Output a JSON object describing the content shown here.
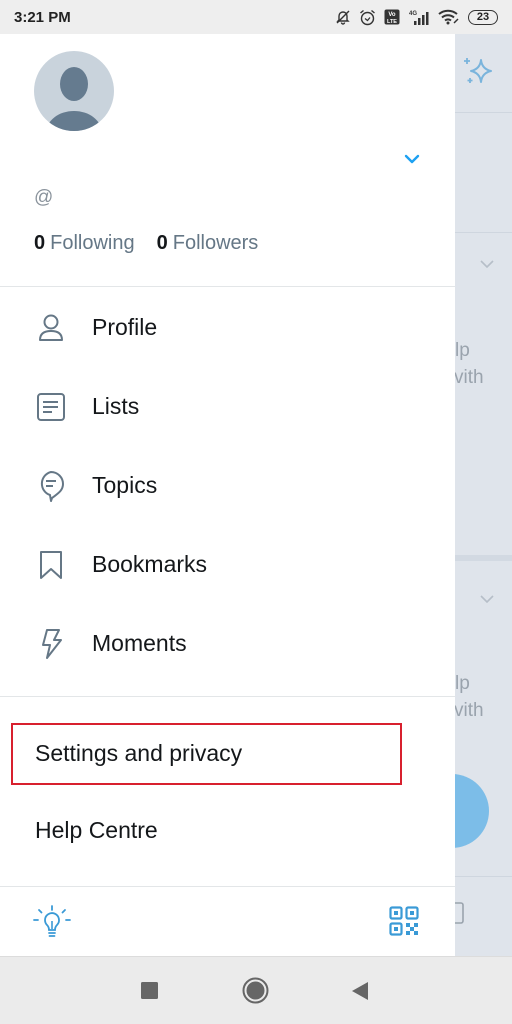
{
  "status_bar": {
    "time": "3:21 PM",
    "icons": [
      "notifications-off-icon",
      "alarm-icon",
      "volte-icon",
      "4g-signal-icon",
      "wifi-icon"
    ],
    "battery": "23"
  },
  "account": {
    "handle_prefix": "@",
    "handle": "",
    "following_count": "0",
    "following_label": "Following",
    "followers_count": "0",
    "followers_label": "Followers"
  },
  "menu": [
    {
      "id": "profile",
      "label": "Profile",
      "icon": "person-icon"
    },
    {
      "id": "lists",
      "label": "Lists",
      "icon": "list-icon"
    },
    {
      "id": "topics",
      "label": "Topics",
      "icon": "topics-icon"
    },
    {
      "id": "bookmarks",
      "label": "Bookmarks",
      "icon": "bookmark-icon"
    },
    {
      "id": "moments",
      "label": "Moments",
      "icon": "lightning-icon"
    }
  ],
  "secondary_menu": [
    {
      "id": "settings",
      "label": "Settings and privacy",
      "highlighted": true
    },
    {
      "id": "help",
      "label": "Help Centre"
    }
  ],
  "footer": {
    "left_icon": "lightbulb-icon",
    "right_icon": "qr-code-icon"
  },
  "background_app": {
    "text_line_1": "lp",
    "text_line_2": "vith",
    "text_line_3": "lp",
    "text_line_4": "vith"
  },
  "colors": {
    "accent": "#1da1f2",
    "icon_blue": "#3a9ad6",
    "highlight": "#d8202e",
    "text_primary": "#14171a",
    "text_secondary": "#657786"
  }
}
